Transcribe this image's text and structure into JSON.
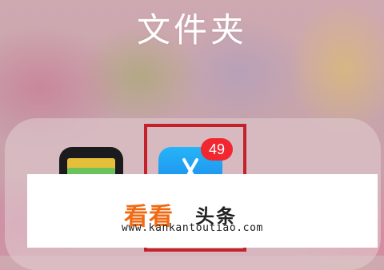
{
  "folder": {
    "title": "文件夹"
  },
  "apps": [
    {
      "name": "wallet",
      "icon": "wallet-icon"
    },
    {
      "name": "app-store",
      "icon": "app-store-icon",
      "badge_count": "49"
    }
  ],
  "watermark": {
    "brand_colored": "看看",
    "brand_dark": "头条",
    "url": "www.kankantoutiao.com"
  },
  "colors": {
    "badge": "#f2262f",
    "highlight_border": "#c4222a",
    "brand_orange": "#f06a13",
    "app_store_blue": "#1a72e8",
    "wallet_bg": "#1b1b1d"
  }
}
